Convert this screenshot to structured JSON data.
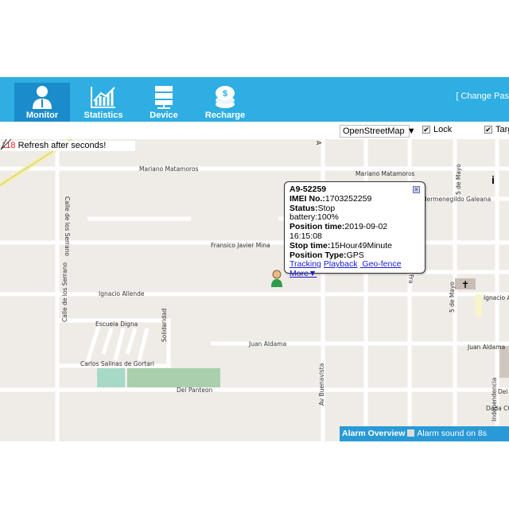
{
  "header": {
    "nav": [
      {
        "label": "Monitor",
        "icon": "user-icon",
        "active": true
      },
      {
        "label": "Statistics",
        "icon": "chart-icon",
        "active": false
      },
      {
        "label": "Device",
        "icon": "server-icon",
        "active": false
      },
      {
        "label": "Recharge",
        "icon": "coins-icon",
        "active": false
      }
    ],
    "change_password": "[ Change Pas"
  },
  "toolbar": {
    "map_type": "OpenStreetMap ▼",
    "lock_label": "Lock",
    "lock_checked": true,
    "target_label": "Targ",
    "target_checked": true
  },
  "refresh": {
    "count": "118",
    "text": " Refresh after seconds!"
  },
  "popup": {
    "device": "A9-52259",
    "imei_label": "IMEI No.:",
    "imei": "1703252259",
    "status_label": "Status:",
    "status": "Stop",
    "battery": "battery:100%",
    "position_time_label": "Position time:",
    "position_time": "2019-09-02 16:15:08",
    "stop_time_label": "Stop time:",
    "stop_time": "15Hour49Minute",
    "position_type_label": "Position Type:",
    "position_type": "GPS",
    "links": [
      "Tracking",
      "Playback",
      " Geo-fence ",
      "More▼"
    ]
  },
  "map_labels": {
    "mariano1": "Mariano Matamoros",
    "mariano2": "Mariano Matamoros",
    "mina": "Fransico Javier Mina",
    "allende1": "Ignacio Allende",
    "allende2": "Ignacio Allende",
    "escuela": "Escuela Digna",
    "solidaridad": "Solidaridad",
    "carlos": "Carlos Salinas de Gortari",
    "panteon1": "Del Panteon",
    "panteon2": "Del P",
    "aldama1": "Juan Aldama",
    "aldama2": "Juan Aldama",
    "serrano1": "Calle de los Serrano",
    "serrano2": "Calle de los Serrano",
    "buenavista": "Av Buenavista",
    "mayo1": "5 de Mayo",
    "mayo2": "5 de Mayo",
    "galeana": "Hermenegildo Galeana",
    "independencia": "Independencia",
    "dada": "Dada CC",
    "fra": "Fra",
    "a": "A"
  },
  "alarm": {
    "title": "Alarm Overview",
    "sound": "Alarm sound on 8s",
    "sound_checked": false
  },
  "colors": {
    "header": "#2eaee3",
    "active_tab": "#1b8ccb",
    "map_bg": "#efece7",
    "alarm_bar": "#2a9ad6"
  }
}
